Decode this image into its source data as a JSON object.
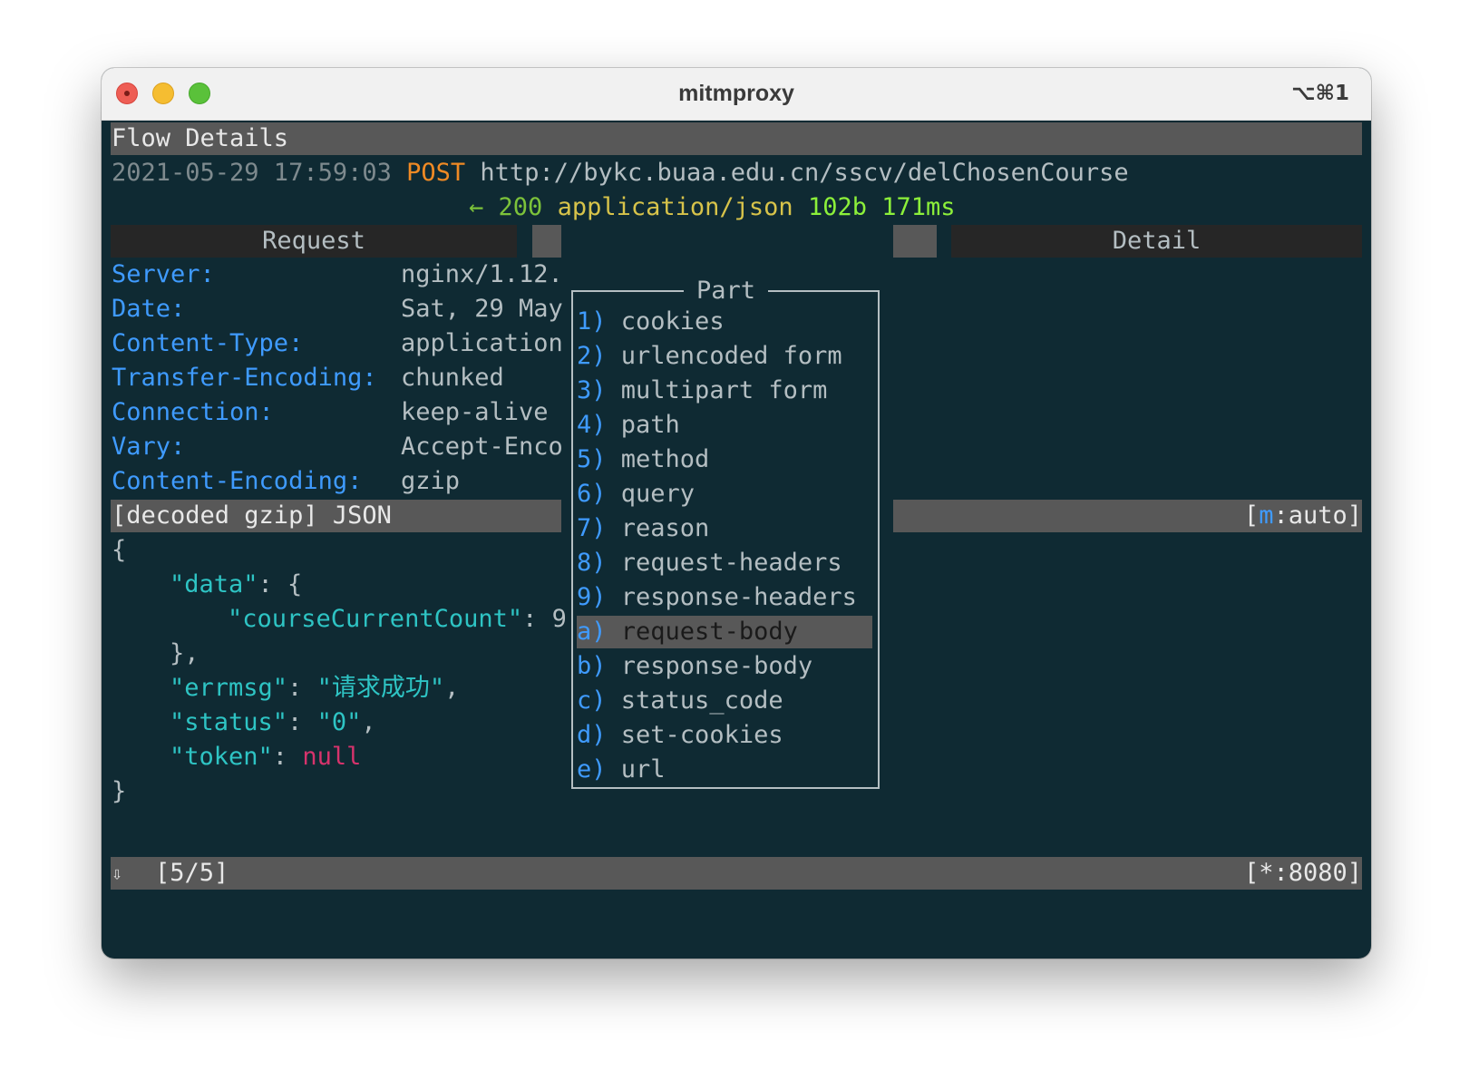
{
  "window": {
    "title": "mitmproxy",
    "shortcut": "⌥⌘1"
  },
  "header": {
    "title": "Flow Details",
    "timestamp": "2021-05-29 17:59:03",
    "method": "POST",
    "url": "http://bykc.buaa.edu.cn/sscv/delChosenCourse",
    "arrow": "←",
    "status": "200",
    "content_type": "application/json",
    "size": "102b",
    "duration": "171ms"
  },
  "tabs": {
    "request": "Request",
    "response_placeholder": "",
    "detail": "Detail"
  },
  "headers": [
    {
      "key": "Server:",
      "value": "nginx/1.12."
    },
    {
      "key": "Date:",
      "value": "Sat, 29 May"
    },
    {
      "key": "Content-Type:",
      "value": "application"
    },
    {
      "key": "Transfer-Encoding:",
      "value": "chunked"
    },
    {
      "key": "Connection:",
      "value": "keep-alive"
    },
    {
      "key": "Vary:",
      "value": "Accept-Enco"
    },
    {
      "key": "Content-Encoding:",
      "value": "gzip"
    }
  ],
  "body_bar": {
    "left": "[decoded gzip] JSON",
    "mode_open": "[",
    "mode_key": "m",
    "mode_rest": ":auto]"
  },
  "json_lines": {
    "l1": "{",
    "l2_key": "\"data\"",
    "l2_rest": ": {",
    "l3_key": "\"courseCurrentCount\"",
    "l3_rest": ": 9",
    "l4": "},",
    "l5_key": "\"errmsg\"",
    "l5_colon": ": ",
    "l5_val": "\"请求成功\"",
    "l5_comma": ",",
    "l6_key": "\"status\"",
    "l6_colon": ": ",
    "l6_val": "\"0\"",
    "l6_comma": ",",
    "l7_key": "\"token\"",
    "l7_colon": ": ",
    "l7_val": "null",
    "l8": "}"
  },
  "popup": {
    "title": "Part",
    "items": [
      {
        "key": "1)",
        "label": "cookies"
      },
      {
        "key": "2)",
        "label": "urlencoded form"
      },
      {
        "key": "3)",
        "label": "multipart form"
      },
      {
        "key": "4)",
        "label": "path"
      },
      {
        "key": "5)",
        "label": "method"
      },
      {
        "key": "6)",
        "label": "query"
      },
      {
        "key": "7)",
        "label": "reason"
      },
      {
        "key": "8)",
        "label": "request-headers"
      },
      {
        "key": "9)",
        "label": "response-headers"
      },
      {
        "key": "a)",
        "label": "request-body"
      },
      {
        "key": "b)",
        "label": "response-body"
      },
      {
        "key": "c)",
        "label": "status_code"
      },
      {
        "key": "d)",
        "label": "set-cookies"
      },
      {
        "key": "e)",
        "label": "url"
      }
    ],
    "selected": "request-body"
  },
  "statusbar": {
    "arrow": "⇩",
    "position": "[5/5]",
    "listen": "[*:8080]"
  }
}
